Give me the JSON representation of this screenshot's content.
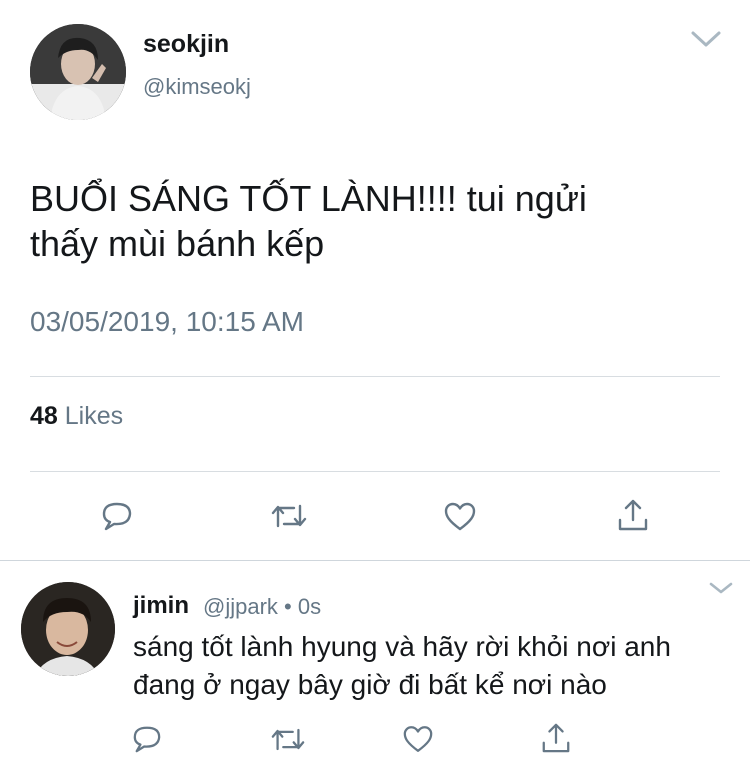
{
  "main_tweet": {
    "display_name": "seokjin",
    "handle": "@kimseokj",
    "text_line1": "BUỔI SÁNG TỐT LÀNH!!!! tui ngửi",
    "text_line2": "thấy mùi bánh kếp",
    "timestamp": "03/05/2019, 10:15 AM",
    "likes_count": "48",
    "likes_label": "Likes",
    "icons": {
      "menu": "chevron-down-icon",
      "reply": "reply-icon",
      "retweet": "retweet-icon",
      "like": "heart-icon",
      "share": "share-icon"
    }
  },
  "reply_tweet": {
    "display_name": "jimin",
    "handle_time": "@jjpark • 0s",
    "text_line1": "sáng tốt lành hyung và hãy rời khỏi nơi anh",
    "text_line2": "đang ở ngay bây giờ đi bất kể nơi nào",
    "icons": {
      "menu": "chevron-down-icon",
      "reply": "reply-icon",
      "retweet": "retweet-icon",
      "like": "heart-icon",
      "share": "share-icon"
    }
  },
  "colors": {
    "text_primary": "#14171a",
    "text_secondary": "#657786",
    "icon": "#657786",
    "divider": "#d8dde1"
  }
}
